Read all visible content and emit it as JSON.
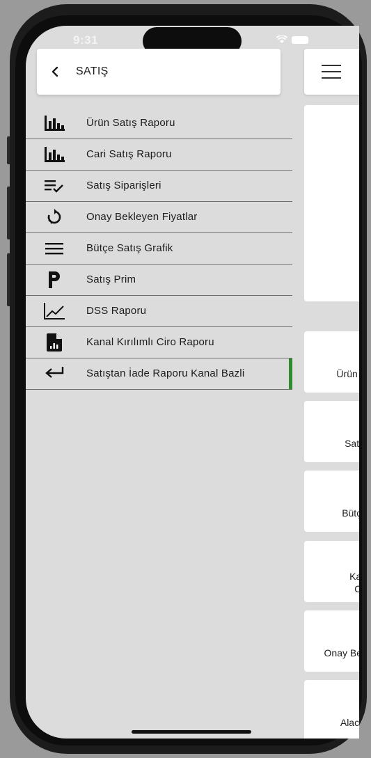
{
  "status": {
    "time": "9:31"
  },
  "sidebar": {
    "title": "SATIŞ",
    "items": [
      {
        "label": "Ürün Satış Raporu",
        "icon": "bar-chart-icon"
      },
      {
        "label": "Cari Satış Raporu",
        "icon": "bar-chart-icon"
      },
      {
        "label": "Satış Siparişleri",
        "icon": "checklist-icon"
      },
      {
        "label": "Onay Bekleyen Fiyatlar",
        "icon": "refresh-icon"
      },
      {
        "label": "Bütçe Satış Grafik",
        "icon": "menu-lines-icon"
      },
      {
        "label": "Satış Prim",
        "icon": "p-letter-icon"
      },
      {
        "label": "DSS Raporu",
        "icon": "line-chart-icon"
      },
      {
        "label": "Kanal Kırılımlı Ciro Raporu",
        "icon": "report-file-icon"
      },
      {
        "label": "Satıştan İade Raporu Kanal Bazli",
        "icon": "return-arrow-icon"
      }
    ],
    "active_index": 8,
    "active_color": "#2e8b2e"
  },
  "main": {
    "cards": [
      {
        "label": "Ürün S"
      },
      {
        "label": "Satış"
      },
      {
        "label": "Bütçe"
      },
      {
        "label": "Kan\nCir"
      },
      {
        "label": "Onay Bek"
      },
      {
        "label": "Alacal"
      }
    ]
  }
}
